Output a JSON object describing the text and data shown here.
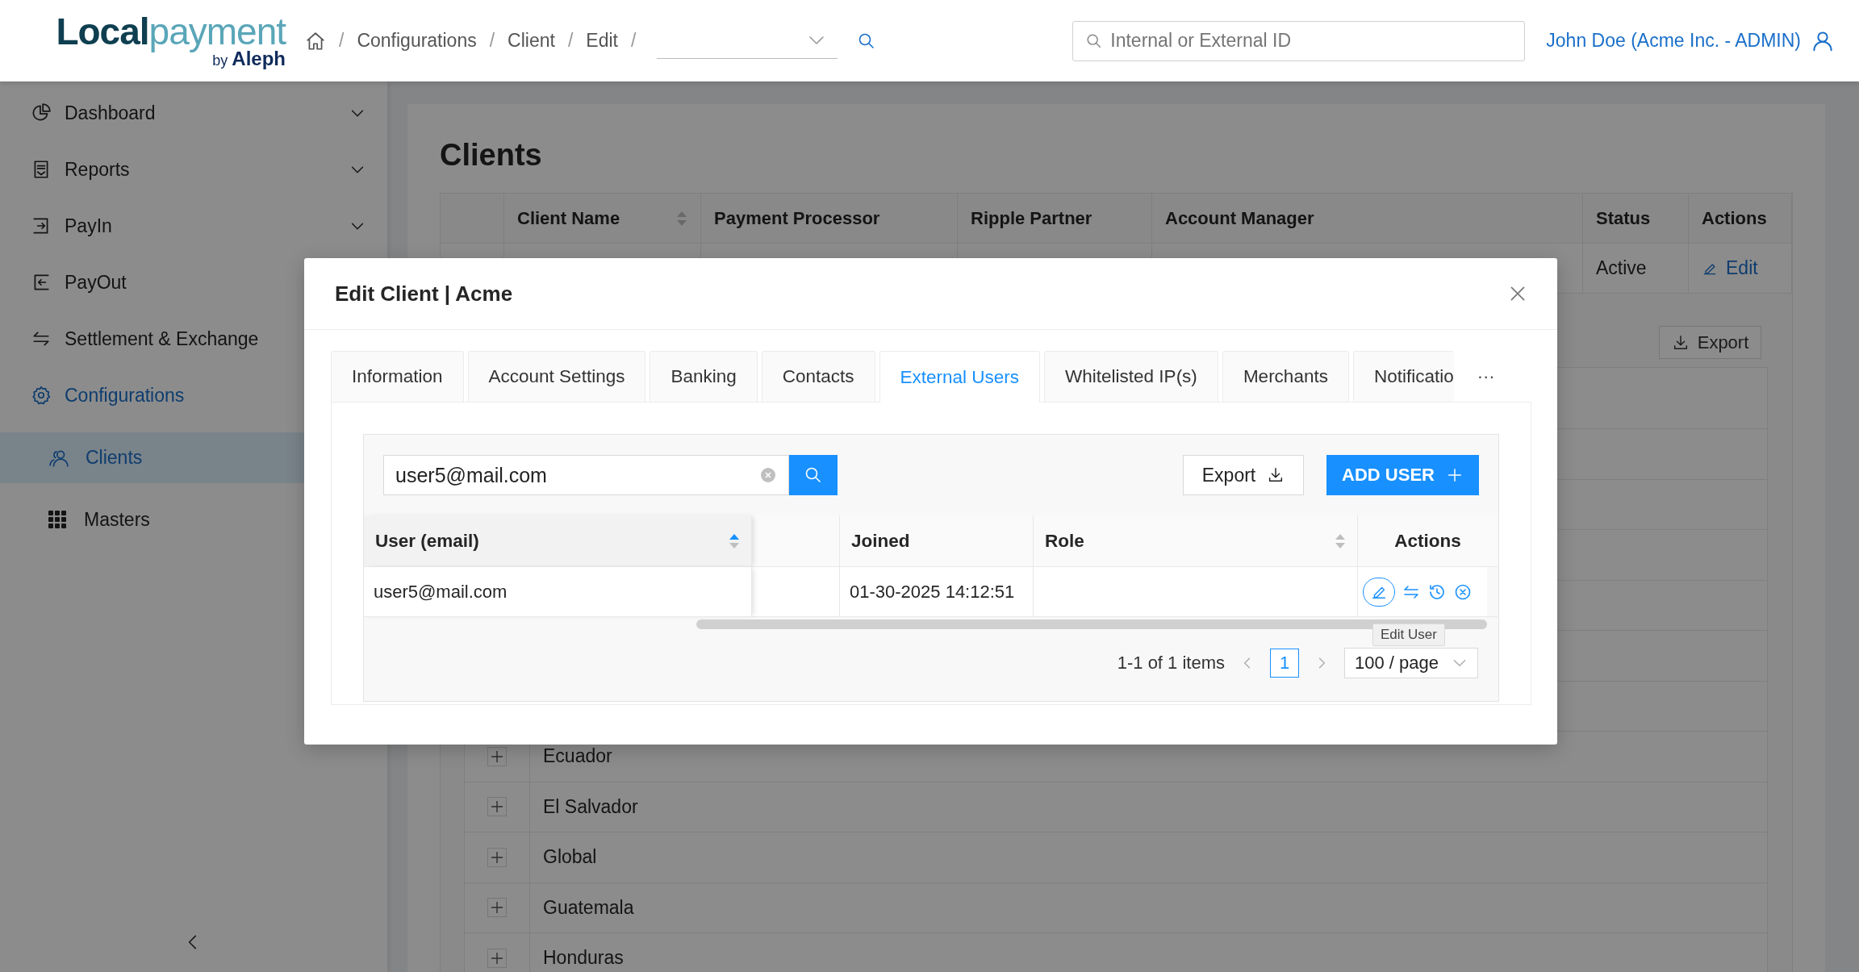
{
  "header": {
    "logo": {
      "word_1": "Local",
      "word_2": "payment",
      "byline": "by **Aleph**"
    },
    "breadcrumb": [
      {
        "kind": "separator",
        "text": "/"
      },
      {
        "kind": "link",
        "text": "Configurations"
      },
      {
        "kind": "separator",
        "text": "/"
      },
      {
        "kind": "link",
        "text": "Client"
      },
      {
        "kind": "separator",
        "text": "/"
      },
      {
        "kind": "link",
        "text": "Edit"
      },
      {
        "kind": "separator",
        "text": "/"
      }
    ],
    "search": {
      "placeholder": "Internal or External ID"
    },
    "user": "John Doe (Acme Inc. - ADMIN)"
  },
  "sidebar": {
    "items": [
      {
        "label": "Dashboard",
        "expanded": false
      },
      {
        "label": "Reports",
        "expanded": false
      },
      {
        "label": "PayIn",
        "expanded": false
      },
      {
        "label": "PayOut"
      },
      {
        "label": "Settlement & Exchange"
      },
      {
        "label": "Configurations",
        "expanded": true,
        "children": [
          {
            "label": "Clients",
            "selected": true
          },
          {
            "label": "Masters",
            "selected": false
          }
        ]
      }
    ]
  },
  "main": {
    "title": "Clients",
    "columns": [
      {
        "label": "Client Name",
        "sortable": true,
        "sorted": false
      },
      {
        "label": "Payment Processor"
      },
      {
        "label": "Ripple Partner"
      },
      {
        "label": "Account Manager"
      },
      {
        "label": "Status"
      },
      {
        "label": "Actions"
      }
    ],
    "rows": [
      {
        "status": "Active",
        "action": "Edit"
      }
    ],
    "export": "Export",
    "regions": [
      "Ecuador",
      "El Salvador",
      "Global",
      "Guatemala",
      "Honduras"
    ]
  },
  "modal": {
    "title": "Edit Client | Acme",
    "tabs": [
      {
        "label": "Information",
        "selected": false
      },
      {
        "label": "Account Settings",
        "selected": false
      },
      {
        "label": "Banking",
        "selected": false
      },
      {
        "label": "Contacts",
        "selected": false
      },
      {
        "label": "External Users",
        "selected": true
      },
      {
        "label": "Whitelisted IP(s)",
        "selected": false
      },
      {
        "label": "Merchants",
        "selected": false
      },
      {
        "label": "Notificatio",
        "selected": false
      }
    ],
    "more": "···",
    "search": {
      "value": "user5@mail.com"
    },
    "export": "Export",
    "add_user": "ADD USER",
    "columns": [
      {
        "label": "User (email)",
        "sortable": true,
        "sorted": true
      },
      {
        "label": "Joined"
      },
      {
        "label": "Role",
        "sortable": true,
        "sorted": false
      },
      {
        "label": "Actions"
      }
    ],
    "rows": [
      {
        "email": "user5@mail.com",
        "joined": "01-30-2025 14:12:51"
      }
    ],
    "tooltip": "Edit User",
    "pagination": {
      "summary": "1-1 of 1 items",
      "pages": [
        {
          "label": "1",
          "selected": true
        }
      ],
      "page_size": "100 / page"
    }
  }
}
